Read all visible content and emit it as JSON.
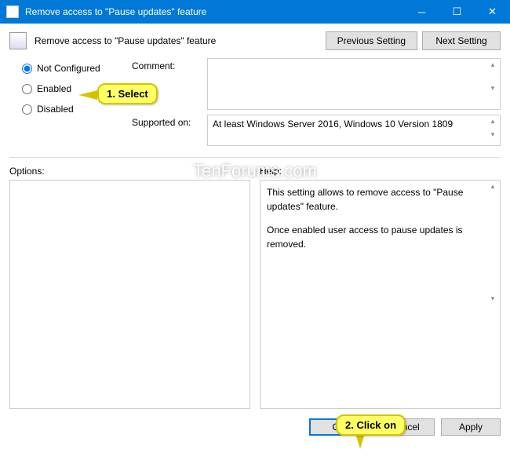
{
  "titlebar": {
    "title": "Remove access to \"Pause updates\" feature"
  },
  "header": {
    "title": "Remove access to \"Pause updates\" feature",
    "prev": "Previous Setting",
    "next": "Next Setting"
  },
  "radios": {
    "not_configured": "Not Configured",
    "enabled": "Enabled",
    "disabled": "Disabled"
  },
  "fields": {
    "comment_label": "Comment:",
    "comment_value": "",
    "supported_label": "Supported on:",
    "supported_value": "At least Windows Server 2016, Windows 10 Version 1809"
  },
  "panels": {
    "options_label": "Options:",
    "help_label": "Help:",
    "help_line1": "This setting allows to remove access to \"Pause updates\" feature.",
    "help_line2": "Once enabled user access to pause updates is removed."
  },
  "buttons": {
    "ok": "OK",
    "cancel": "Cancel",
    "apply": "Apply"
  },
  "annotations": {
    "c1": "1. Select",
    "c2": "2. Click on"
  },
  "watermark": "TenForums.com"
}
